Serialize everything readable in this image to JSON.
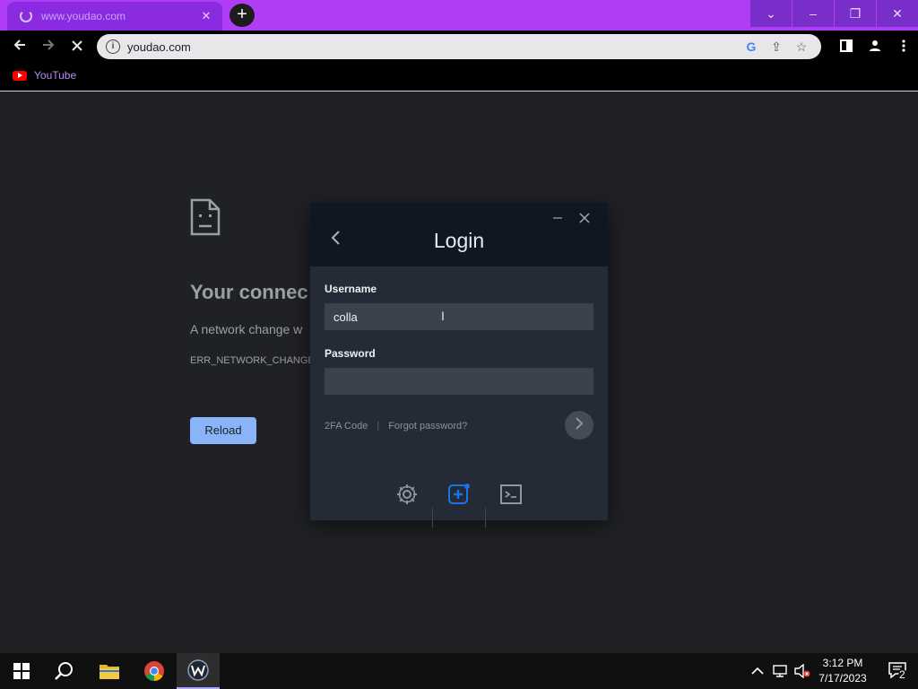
{
  "browser": {
    "tab_title": "www.youdao.com",
    "url": "youdao.com",
    "bookmark_youtube": "YouTube"
  },
  "window_controls": {
    "dropdown": "⌄",
    "minimize": "–",
    "restore": "❐",
    "close": "✕"
  },
  "error_page": {
    "title": "Your connec",
    "description": "A network change w",
    "code": "ERR_NETWORK_CHANGE",
    "reload_label": "Reload"
  },
  "login": {
    "title": "Login",
    "username_label": "Username",
    "username_value": "colla",
    "password_label": "Password",
    "password_value": "",
    "twofa_link": "2FA Code",
    "separator": "|",
    "forgot_link": "Forgot password?"
  },
  "taskbar": {
    "time": "3:12 PM",
    "date": "7/17/2023",
    "notification_count": "2"
  },
  "colors": {
    "tab_bar": "#b03cf6",
    "accent_blue": "#1a73e8",
    "reload_button": "#8ab4f8"
  },
  "icons": [
    "search-icon",
    "gear-icon",
    "add-icon",
    "terminal-icon",
    "chevron-left-icon",
    "close-icon"
  ]
}
